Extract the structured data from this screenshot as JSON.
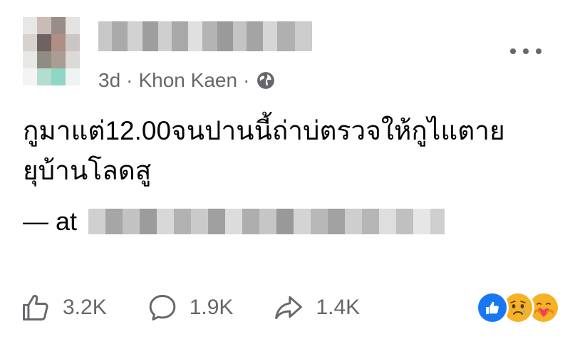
{
  "post": {
    "time": "3d",
    "separator": "·",
    "location": "Khon Kaen",
    "separator2": "·",
    "privacy_icon": "globe-icon",
    "text_line1": "กูมาแต่12.00จนปานนี้ถ่าบ่ตรวจให้กูไแตาย",
    "text_line2": "ยุบ้านโลดสู",
    "checkin_prefix": "— at"
  },
  "actions": {
    "like_count": "3.2K",
    "comment_count": "1.9K",
    "share_count": "1.4K"
  },
  "icons": {
    "like": "thumbs-up-icon",
    "comment": "comment-bubble-icon",
    "share": "share-arrow-icon",
    "more": "more-options-icon"
  },
  "reactions": [
    "like",
    "sad",
    "care"
  ],
  "colors": {
    "meta_text": "#65676b",
    "body_text": "#050505",
    "like_blue": "#1877f2",
    "emoji_yellow": "#f7b125"
  }
}
